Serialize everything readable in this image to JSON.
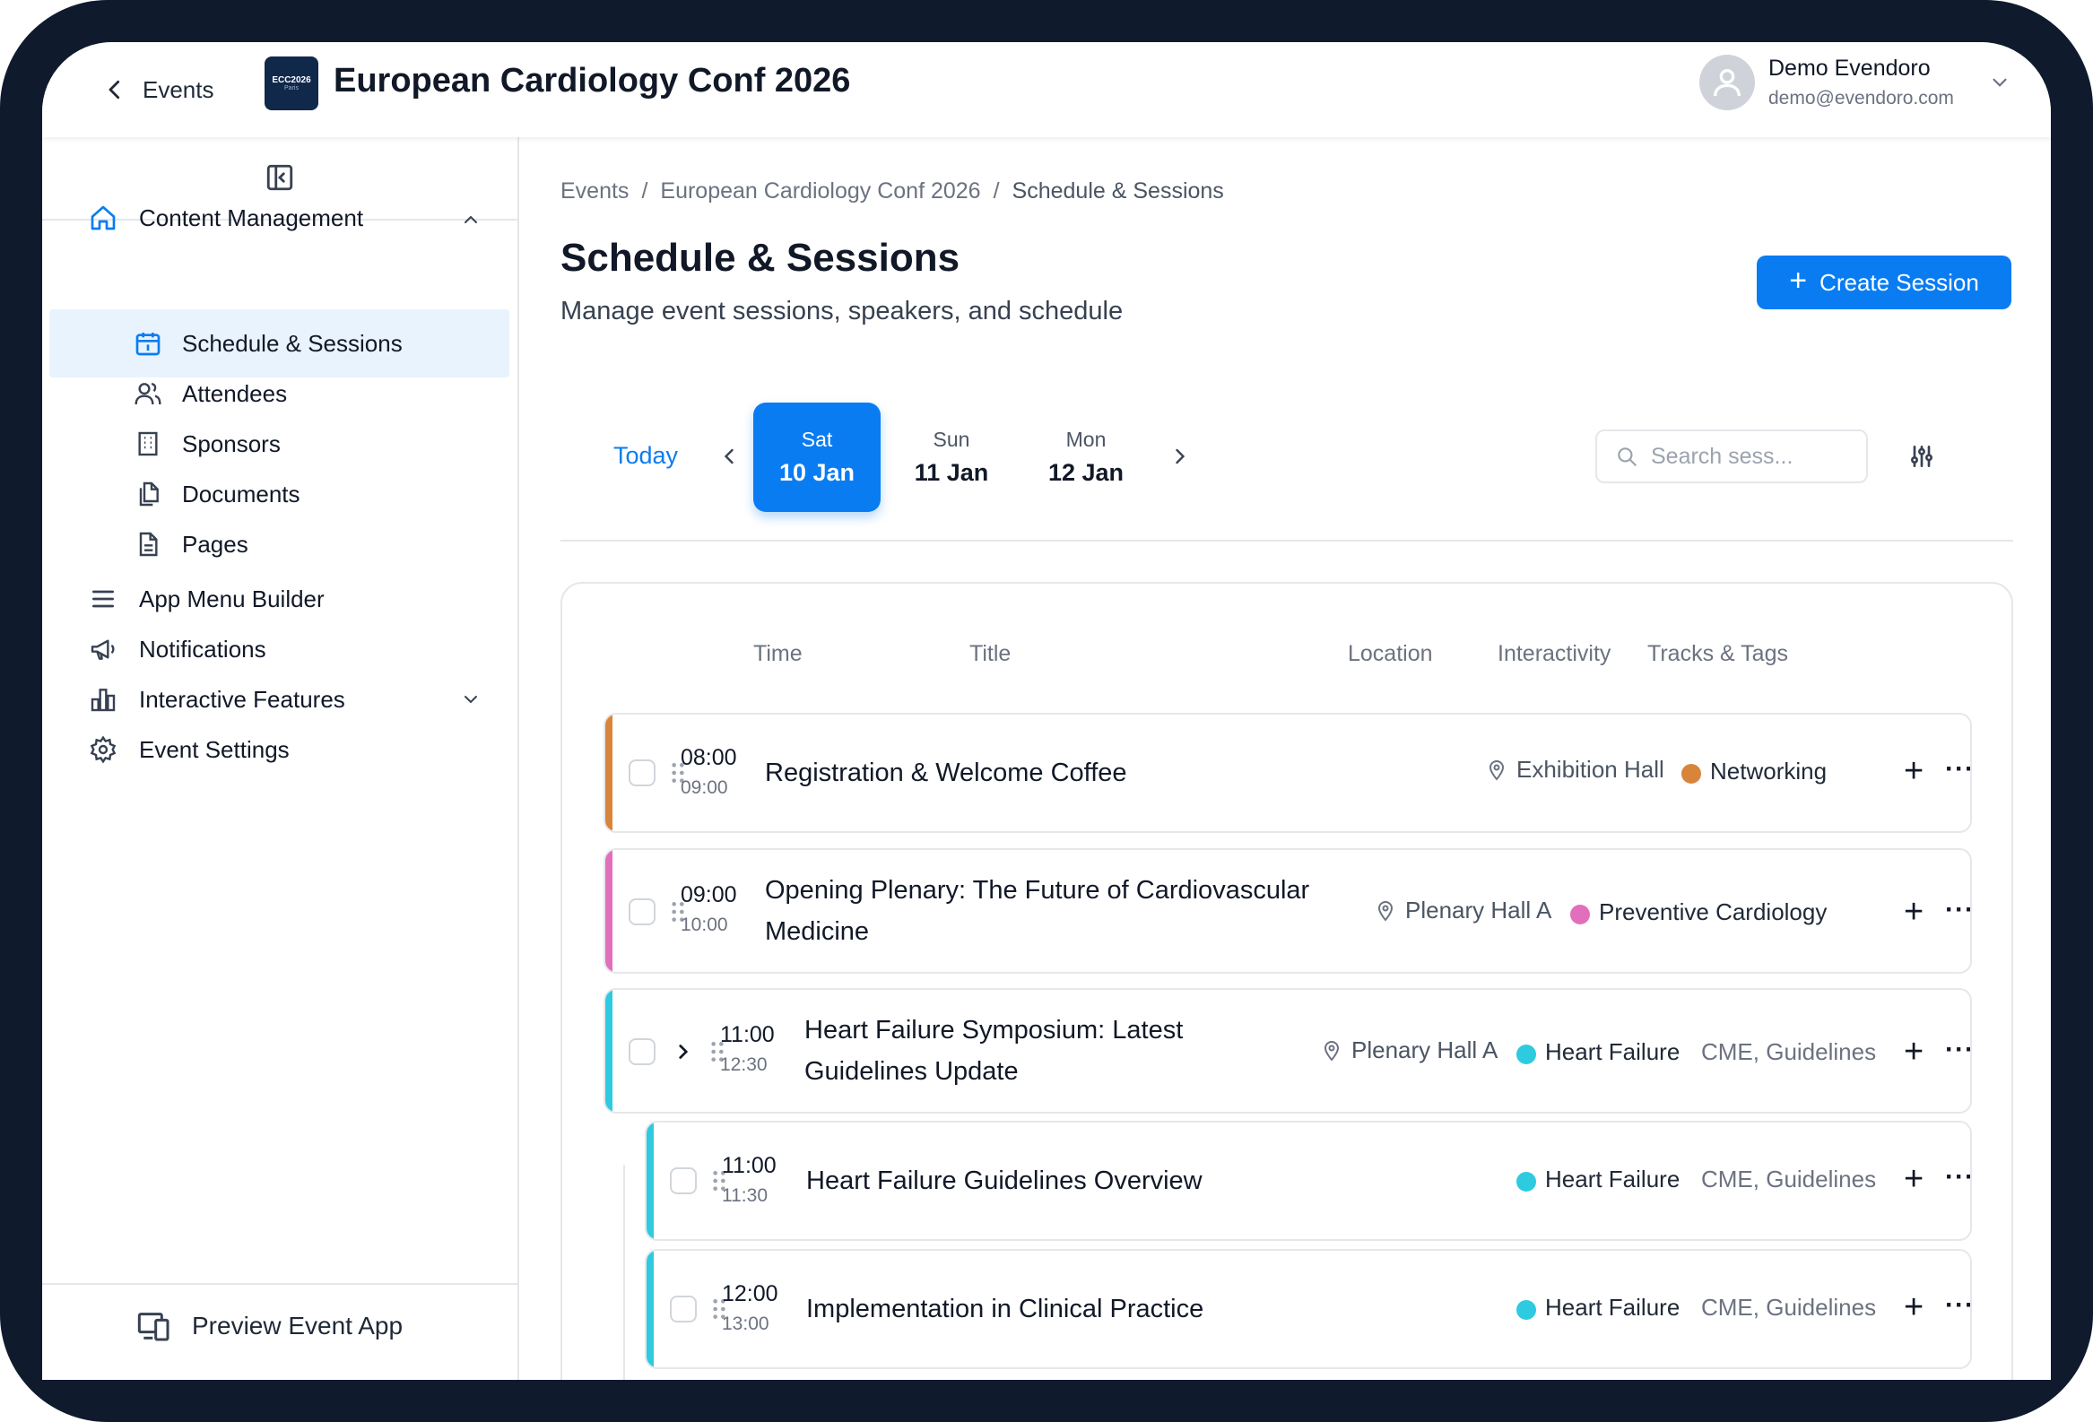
{
  "header": {
    "back_label": "Events",
    "logo": {
      "line1": "ECC2026",
      "line2": "Paris"
    },
    "event_title": "European Cardiology Conf 2026",
    "user": {
      "name": "Demo Evendoro",
      "email": "demo@evendoro.com"
    }
  },
  "sidebar": {
    "content_management": "Content Management",
    "sub_items": [
      {
        "label": "Schedule & Sessions",
        "icon": "calendar-icon",
        "active": true
      },
      {
        "label": "Attendees",
        "icon": "users-icon"
      },
      {
        "label": "Sponsors",
        "icon": "building-icon"
      },
      {
        "label": "Documents",
        "icon": "documents-icon"
      },
      {
        "label": "Pages",
        "icon": "page-icon"
      }
    ],
    "main_items": [
      {
        "label": "App Menu Builder",
        "icon": "menu-icon"
      },
      {
        "label": "Notifications",
        "icon": "megaphone-icon"
      },
      {
        "label": "Interactive Features",
        "icon": "chart-icon"
      },
      {
        "label": "Event Settings",
        "icon": "gear-icon"
      }
    ],
    "preview_label": "Preview Event App"
  },
  "breadcrumb": [
    "Events",
    "European Cardiology Conf 2026",
    "Schedule & Sessions"
  ],
  "page": {
    "title": "Schedule & Sessions",
    "subtitle": "Manage event sessions, speakers, and schedule",
    "create_label": "Create Session"
  },
  "dates": {
    "today_label": "Today",
    "days": [
      {
        "dow": "Sat",
        "date": "10 Jan",
        "active": true
      },
      {
        "dow": "Sun",
        "date": "11 Jan"
      },
      {
        "dow": "Mon",
        "date": "12 Jan"
      }
    ]
  },
  "search": {
    "placeholder": "Search sess..."
  },
  "table": {
    "columns": [
      "Time",
      "Title",
      "Location",
      "Interactivity",
      "Tracks & Tags"
    ],
    "rows": [
      {
        "start": "08:00",
        "end": "09:00",
        "title": "Registration & Welcome Coffee",
        "location": "Exhibition Hall",
        "track": "Networking",
        "tags": "",
        "color": "#d9843b"
      },
      {
        "start": "09:00",
        "end": "10:00",
        "title_l1": "Opening Plenary: The Future of Cardiovascular",
        "title_l2": "Medicine",
        "location": "Plenary Hall A",
        "track": "Preventive Cardiology",
        "tags": "",
        "color": "#e26fbb"
      },
      {
        "start": "11:00",
        "end": "12:30",
        "title_l1": "Heart Failure Symposium: Latest",
        "title_l2": "Guidelines Update",
        "location": "Plenary Hall A",
        "track": "Heart Failure",
        "tags": "CME, Guidelines",
        "color": "#2ecbe0"
      },
      {
        "start": "11:00",
        "end": "11:30",
        "title": "Heart Failure Guidelines Overview",
        "track": "Heart Failure",
        "tags": "CME, Guidelines",
        "color": "#2ecbe0"
      },
      {
        "start": "12:00",
        "end": "13:00",
        "title": "Implementation in Clinical Practice",
        "track": "Heart Failure",
        "tags": "CME, Guidelines",
        "color": "#2ecbe0"
      }
    ],
    "add_symbol": "+",
    "more_symbol": "···"
  }
}
